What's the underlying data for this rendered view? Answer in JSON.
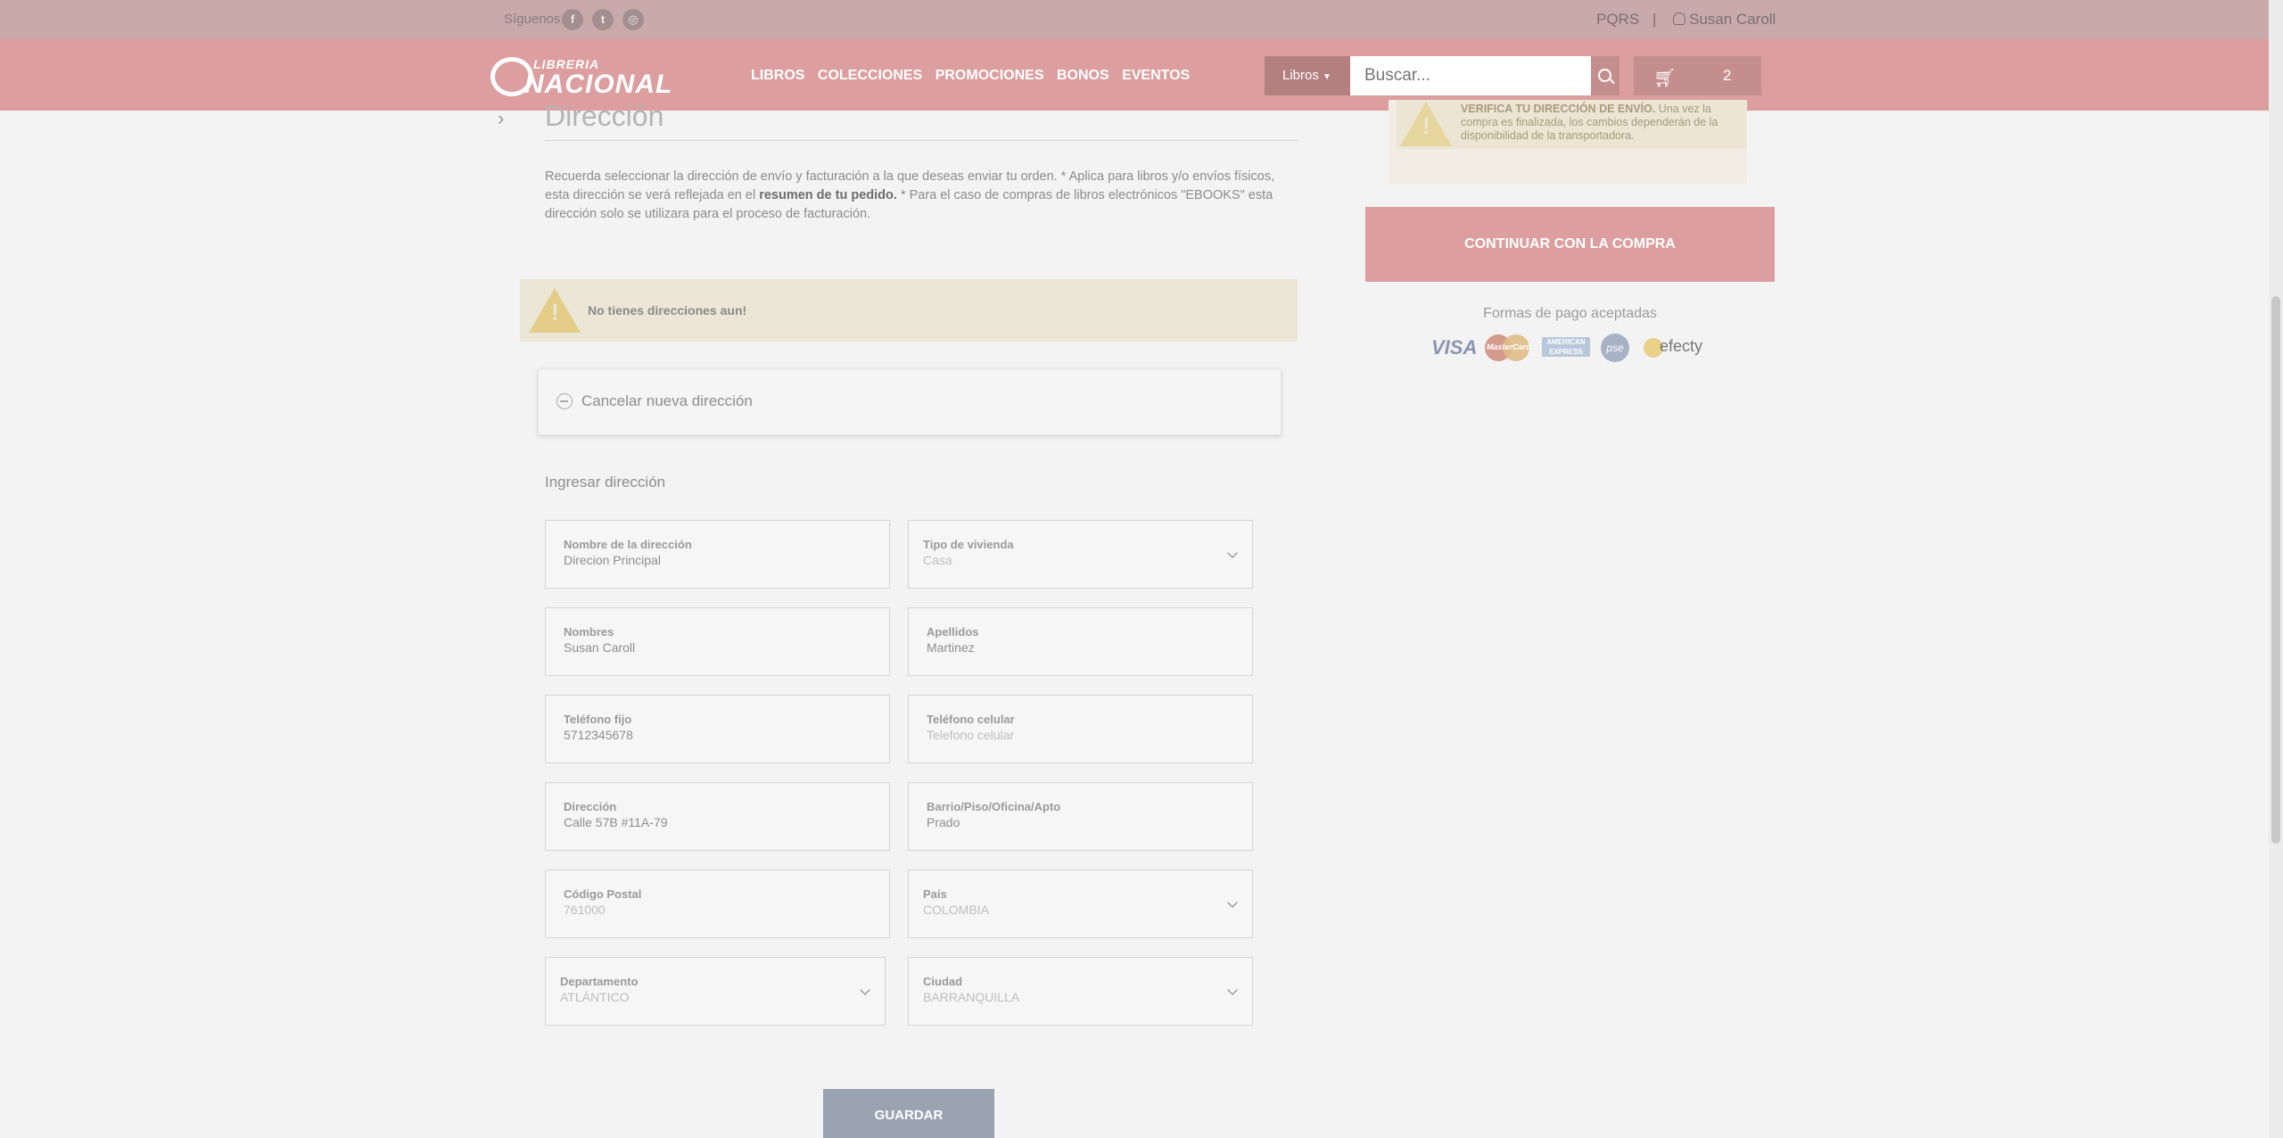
{
  "topbar": {
    "follow_label": "Síguenos",
    "social": [
      {
        "icon": "facebook-icon",
        "glyph": "f"
      },
      {
        "icon": "twitter-icon",
        "glyph": "t"
      },
      {
        "icon": "instagram-icon",
        "glyph": "◎"
      }
    ],
    "pqrs": "PQRS",
    "separator": "|",
    "user_name": "Susan Caroll"
  },
  "nav": {
    "logo_line1": "LIBRERIA",
    "logo_line2": "NACIONAL",
    "links": [
      "LIBROS",
      "COLECCIONES",
      "PROMOCIONES",
      "BONOS",
      "EVENTOS"
    ],
    "category_select": "Libros",
    "search_placeholder": "Buscar...",
    "cart_count": "2"
  },
  "address": {
    "title": "Dirección",
    "desc_part1": "Recuerda seleccionar la dirección de envío y facturación a la que deseas enviar tu orden. * Aplica para libros y/o envíos físicos, esta dirección se verá reflejada en el ",
    "desc_bold": "resumen de tu pedido.",
    "desc_part2": " * Para el caso de compras de libros electrónicos \"EBOOKS\" esta dirección solo se utilizara para el proceso de facturación.",
    "warning_text": "No tienes direcciones aun!",
    "cancel_label": "Cancelar nueva dirección",
    "form_title": "Ingresar dirección",
    "fields": {
      "nombre_dir": {
        "label": "Nombre de la dirección",
        "value": "Direcion Principal"
      },
      "tipo_vivienda": {
        "label": "Tipo de vivienda",
        "value": "Casa"
      },
      "nombres": {
        "label": "Nombres",
        "value": "Susan Caroll"
      },
      "apellidos": {
        "label": "Apellidos",
        "value": "Martinez"
      },
      "tel_fijo": {
        "label": "Teléfono fijo",
        "value": "5712345678"
      },
      "tel_celular": {
        "label": "Teléfono celular",
        "placeholder": "Telefono celular"
      },
      "direccion": {
        "label": "Dirección",
        "value": "Calle 57B #11A-79"
      },
      "barrio": {
        "label": "Barrio/Piso/Oficina/Apto",
        "value": "Prado"
      },
      "postal": {
        "label": "Código Postal",
        "value": "761000"
      },
      "pais": {
        "label": "País",
        "value": "COLOMBIA"
      },
      "departamento": {
        "label": "Departamento",
        "value": "ATLÁNTICO"
      },
      "ciudad": {
        "label": "Ciudad",
        "value": "BARRANQUILLA"
      }
    },
    "save_label": "GUARDAR"
  },
  "sidebar": {
    "notice_bold": "VERIFICA TU DIRECCIÓN DE ENVÍO.",
    "notice_text": " Una vez la compra es finalizada, los cambios dependerán de la disponibilidad de la transportadora.",
    "continue_label": "CONTINUAR CON LA COMPRA",
    "payment_title": "Formas de pago aceptadas",
    "payment_methods": [
      "VISA",
      "MasterCard",
      "AMERICAN EXPRESS",
      "pse",
      "efecty"
    ]
  }
}
